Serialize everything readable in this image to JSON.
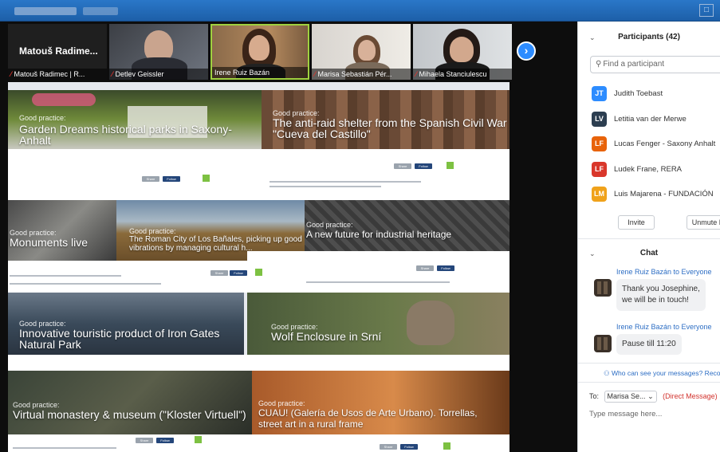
{
  "window": {
    "minimize": "□"
  },
  "thumbnails": [
    {
      "big_name": "Matouš Radime...",
      "label": "Matouš Radimec | R...",
      "muted": true
    },
    {
      "label": "Detlev Geissler",
      "muted": true
    },
    {
      "label": "Irene Ruiz Bazán",
      "muted": false,
      "active": true
    },
    {
      "label": "Marisa Sebastián Pér...",
      "muted": true
    },
    {
      "label": "Mihaela Stanciulescu",
      "muted": true
    }
  ],
  "nav_next": "›",
  "share": {
    "cards": [
      {
        "gp": "Good practice:",
        "title": "Garden Dreams historical parks in Saxony-Anhalt"
      },
      {
        "gp": "Good practice:",
        "title": "The anti-raid shelter from the Spanish Civil War \"Cueva del Castillo\""
      },
      {
        "gp": "Good practice:",
        "title": "Monuments live"
      },
      {
        "gp": "Good practice:",
        "title": "The Roman City of Los Bañales, picking up good vibrations by managing cultural h..."
      },
      {
        "gp": "Good practice:",
        "title": "A new future for industrial heritage"
      },
      {
        "gp": "Good practice:",
        "title": "Innovative touristic product of Iron Gates Natural Park"
      },
      {
        "gp": "Good practice:",
        "title": "Wolf Enclosure in Srní"
      },
      {
        "gp": "Good practice:",
        "title": "Virtual monastery & museum (\"Kloster Virtuell\")"
      },
      {
        "gp": "Good practice:",
        "title": "CUAU! (Galería de Usos de Arte Urbano). Torrellas, street art in a rural frame"
      }
    ],
    "mini_share": "Share",
    "mini_follow": "Follow"
  },
  "panel": {
    "participants_title": "Participants (42)",
    "search_placeholder": "Find a participant",
    "participants": [
      {
        "initials": "JT",
        "name": "Judith Toebast",
        "color": "#2d8cff"
      },
      {
        "initials": "LV",
        "name": "Letitia van der Merwe",
        "color": "#2c3e50"
      },
      {
        "initials": "LF",
        "name": "Lucas Fenger - Saxony Anhalt",
        "color": "#e8630a"
      },
      {
        "initials": "LF",
        "name": "Ludek Frane, RERA",
        "color": "#d9372b"
      },
      {
        "initials": "LM",
        "name": "Luis Majarena - FUNDACIÓN",
        "color": "#f0a21b"
      }
    ],
    "invite": "Invite",
    "unmute": "Unmute Me",
    "chat_title": "Chat",
    "messages": [
      {
        "from": "Irene Ruiz Bazán to Everyone",
        "text_line1": "Thank you Josephine,",
        "text_line2": "we will be in touch!"
      },
      {
        "from": "Irene Ruiz Bazán to Everyone",
        "text_line1": "Pause till 11:20"
      }
    ],
    "who_can_see": "Who can see your messages? Recording...",
    "to_label": "To:",
    "to_value": "Marisa Se...",
    "to_chevron": "⌄",
    "direct_message": "(Direct Message)",
    "type_placeholder": "Type message here..."
  }
}
